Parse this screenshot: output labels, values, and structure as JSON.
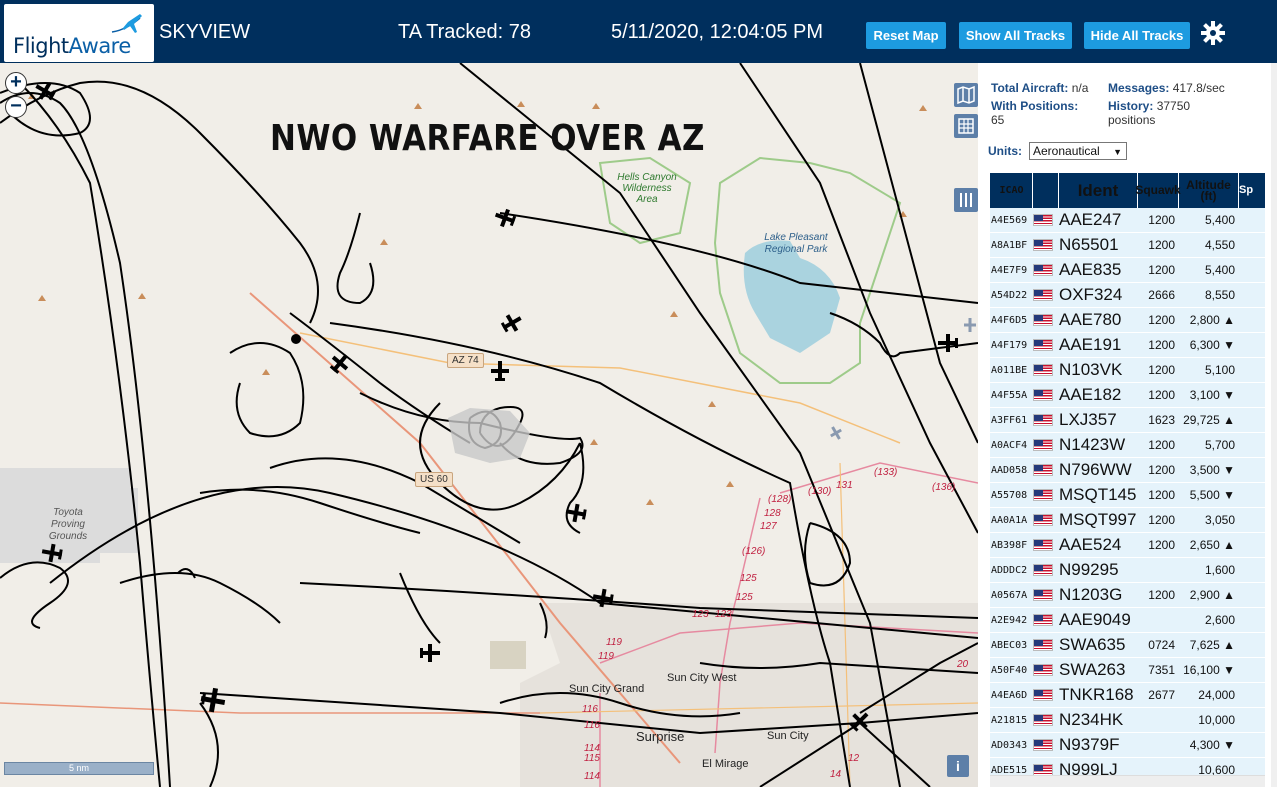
{
  "header": {
    "logo_flight": "Flight",
    "logo_aware": "Aware",
    "app_name": "SKYVIEW",
    "tracked": "TA Tracked: 78",
    "clock": "5/11/2020, 12:04:05 PM",
    "buttons": {
      "reset": "Reset Map",
      "show_all": "Show All Tracks",
      "hide_all": "Hide All Tracks"
    }
  },
  "map": {
    "title": "NWO WARFARE OVER AZ",
    "zoom_in": "+",
    "zoom_out": "−",
    "scale": "5 nm",
    "info": "i",
    "labels": {
      "hells_canyon": "Hells Canyon Wilderness Area",
      "lake_pleasant": "Lake Pleasant Regional Park",
      "toyota": "Toyota Proving Grounds",
      "az74": "AZ 74",
      "us60": "US 60",
      "sun_city_grand": "Sun City Grand",
      "sun_city_west": "Sun City West",
      "surprise": "Surprise",
      "sun_city": "Sun City",
      "el_mirage": "El Mirage"
    },
    "road_numbers": [
      "(128)",
      "128",
      "(130)",
      "131",
      "(133)",
      "(136)",
      "127",
      "(126)",
      "125",
      "125",
      "123",
      "123",
      "119",
      "119",
      "116",
      "116",
      "115",
      "114",
      "114",
      "14",
      "12",
      "20"
    ]
  },
  "sidebar": {
    "total_aircraft_label": "Total Aircraft:",
    "total_aircraft_value": "n/a",
    "messages_label": "Messages:",
    "messages_value": "417.8/sec",
    "with_positions_label": "With Positions:",
    "with_positions_value": "65",
    "history_label": "History:",
    "history_value": "37750 positions",
    "units_label": "Units:",
    "units_value": "Aeronautical"
  },
  "table": {
    "headers": {
      "icao": "ICAO",
      "flag": "",
      "ident": "Ident",
      "squawk": "Squawk",
      "altitude": "Altitude (ft)",
      "speed": "Sp"
    },
    "rows": [
      {
        "icao": "A4E569",
        "ident": "AAE247",
        "squawk": "1200",
        "altitude": "5,400",
        "trend": ""
      },
      {
        "icao": "A8A1BF",
        "ident": "N65501",
        "squawk": "1200",
        "altitude": "4,550",
        "trend": ""
      },
      {
        "icao": "A4E7F9",
        "ident": "AAE835",
        "squawk": "1200",
        "altitude": "5,400",
        "trend": ""
      },
      {
        "icao": "A54D22",
        "ident": "OXF324",
        "squawk": "2666",
        "altitude": "8,550",
        "trend": ""
      },
      {
        "icao": "A4F6D5",
        "ident": "AAE780",
        "squawk": "1200",
        "altitude": "2,800 ▲",
        "trend": "up"
      },
      {
        "icao": "A4F179",
        "ident": "AAE191",
        "squawk": "1200",
        "altitude": "6,300 ▼",
        "trend": "down"
      },
      {
        "icao": "A011BE",
        "ident": "N103VK",
        "squawk": "1200",
        "altitude": "5,100",
        "trend": ""
      },
      {
        "icao": "A4F55A",
        "ident": "AAE182",
        "squawk": "1200",
        "altitude": "3,100 ▼",
        "trend": "down"
      },
      {
        "icao": "A3FF61",
        "ident": "LXJ357",
        "squawk": "1623",
        "altitude": "29,725 ▲",
        "trend": "up"
      },
      {
        "icao": "A0ACF4",
        "ident": "N1423W",
        "squawk": "1200",
        "altitude": "5,700",
        "trend": ""
      },
      {
        "icao": "AAD058",
        "ident": "N796WW",
        "squawk": "1200",
        "altitude": "3,500 ▼",
        "trend": "down"
      },
      {
        "icao": "A55708",
        "ident": "MSQT145",
        "squawk": "1200",
        "altitude": "5,500 ▼",
        "trend": "down"
      },
      {
        "icao": "AA0A1A",
        "ident": "MSQT997",
        "squawk": "1200",
        "altitude": "3,050",
        "trend": ""
      },
      {
        "icao": "AB398F",
        "ident": "AAE524",
        "squawk": "1200",
        "altitude": "2,650 ▲",
        "trend": "up"
      },
      {
        "icao": "ADDDC2",
        "ident": "N99295",
        "squawk": "",
        "altitude": "1,600",
        "trend": ""
      },
      {
        "icao": "A0567A",
        "ident": "N1203G",
        "squawk": "1200",
        "altitude": "2,900 ▲",
        "trend": "up"
      },
      {
        "icao": "A2E942",
        "ident": "AAE9049",
        "squawk": "",
        "altitude": "2,600",
        "trend": ""
      },
      {
        "icao": "ABEC03",
        "ident": "SWA635",
        "squawk": "0724",
        "altitude": "7,625 ▲",
        "trend": "up"
      },
      {
        "icao": "A50F40",
        "ident": "SWA263",
        "squawk": "7351",
        "altitude": "16,100 ▼",
        "trend": "down"
      },
      {
        "icao": "A4EA6D",
        "ident": "TNKR168",
        "squawk": "2677",
        "altitude": "24,000",
        "trend": ""
      },
      {
        "icao": "A21815",
        "ident": "N234HK",
        "squawk": "",
        "altitude": "10,000",
        "trend": ""
      },
      {
        "icao": "AD0343",
        "ident": "N9379F",
        "squawk": "",
        "altitude": "4,300 ▼",
        "trend": "down"
      },
      {
        "icao": "ADE515",
        "ident": "N999LJ",
        "squawk": "",
        "altitude": "10,600",
        "trend": ""
      }
    ]
  },
  "colors": {
    "header_bg": "#002f5d",
    "button_bg": "#1d9be0",
    "map_bg": "#f1eee8",
    "row_bg": "#e5f3fb",
    "track": "#000000"
  }
}
